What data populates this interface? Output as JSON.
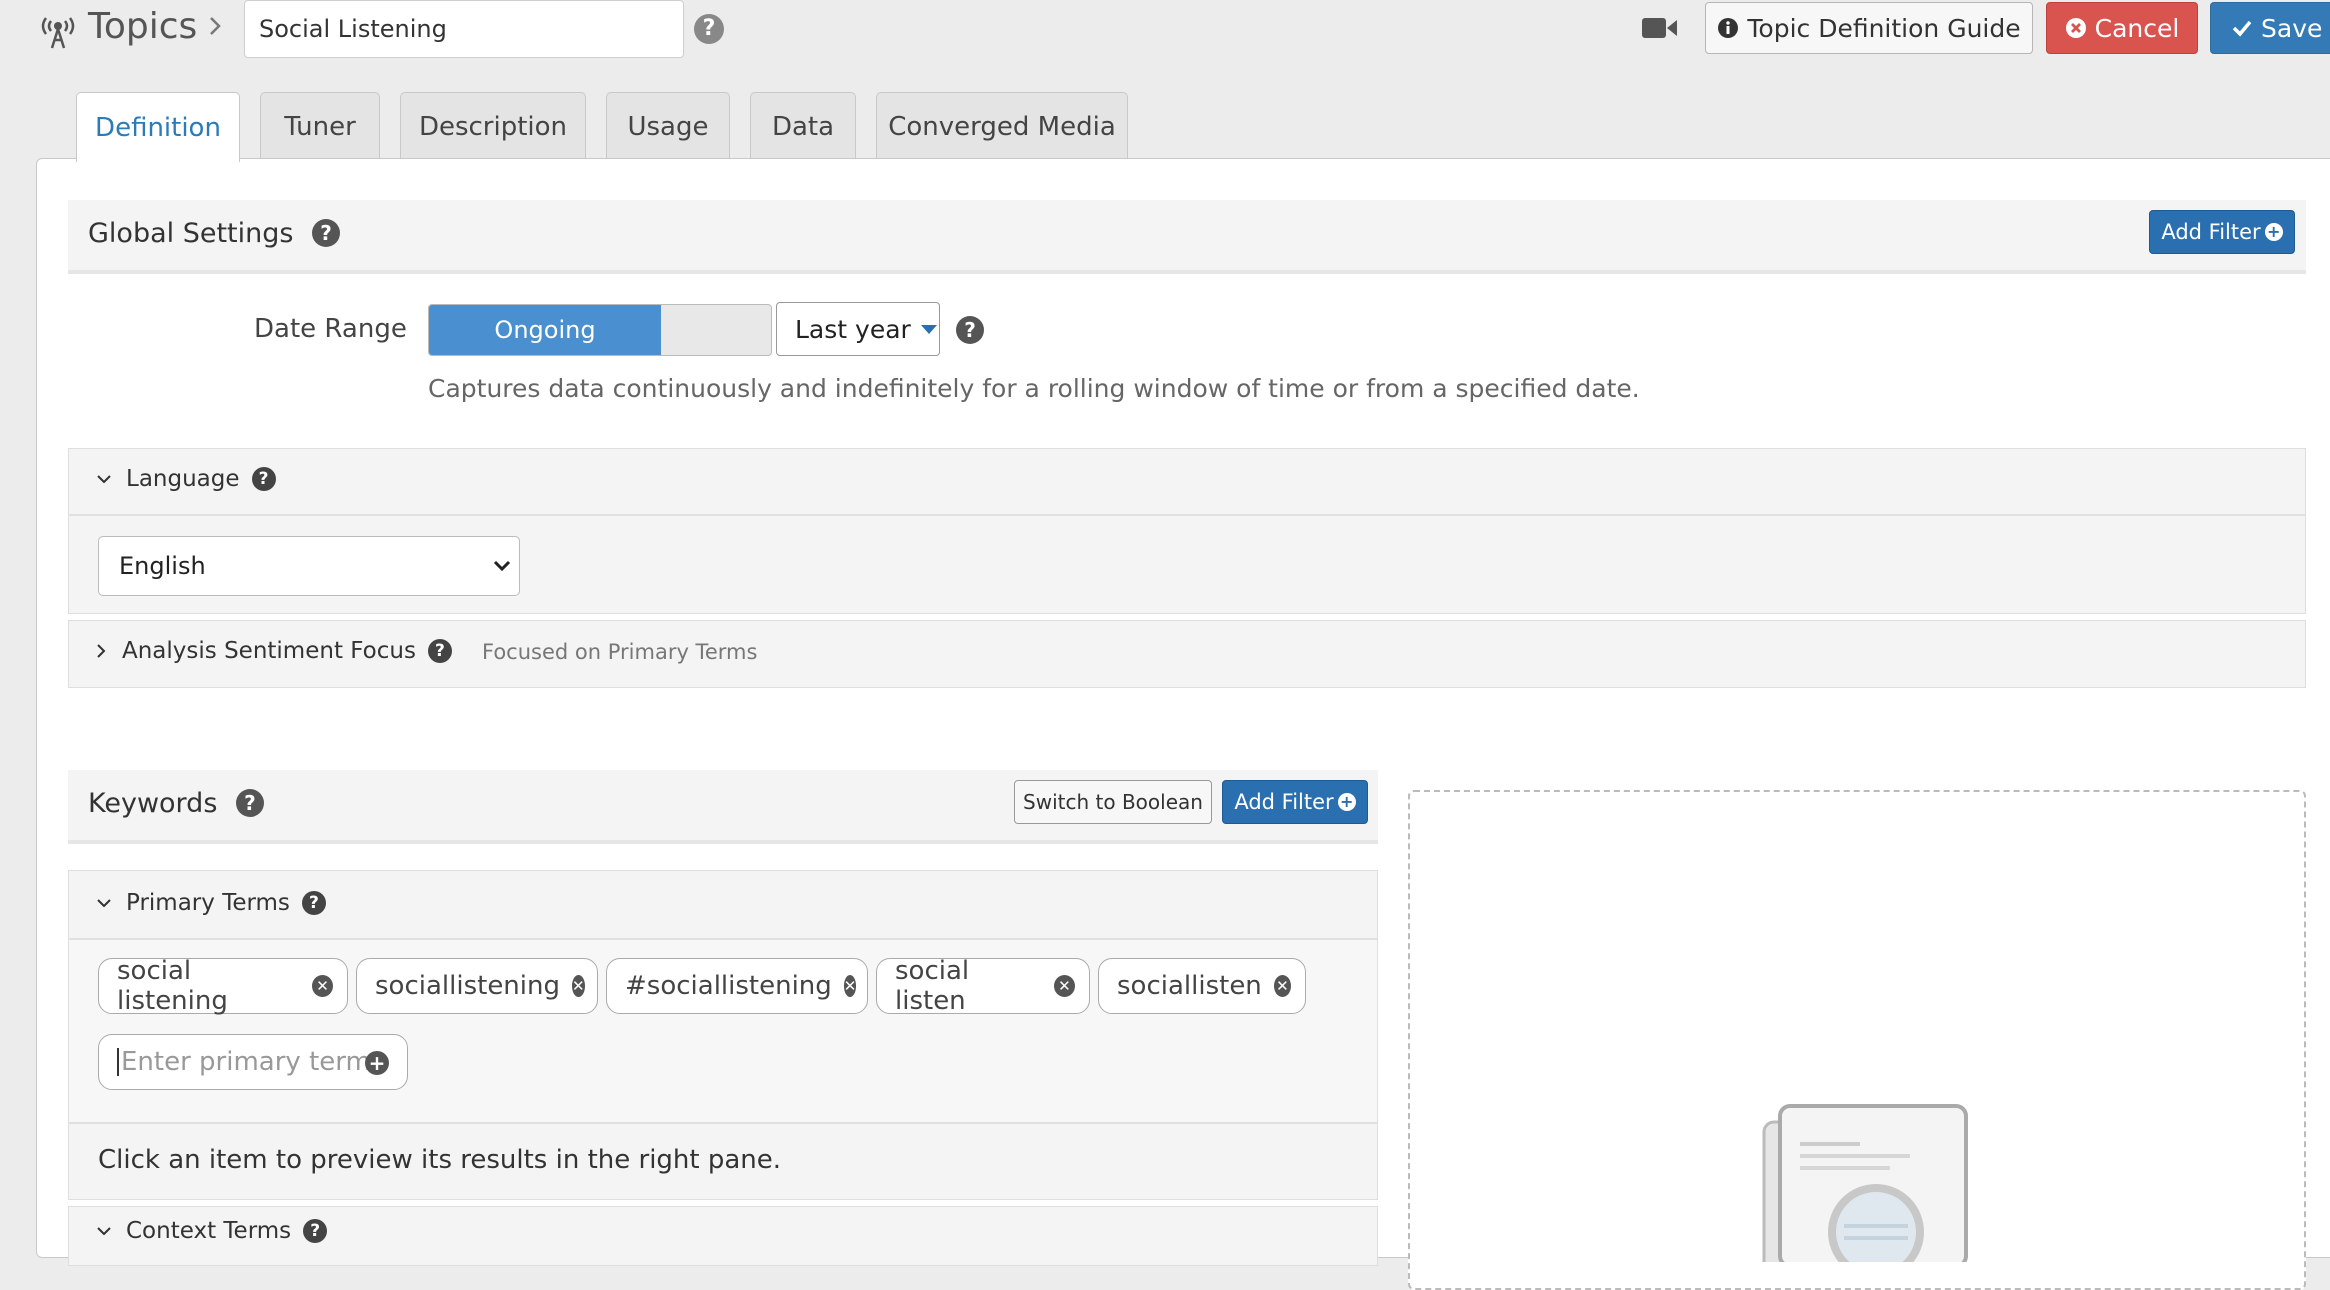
{
  "header": {
    "breadcrumb_title": "Topics",
    "topic_name": "Social Listening",
    "guide_button": "Topic Definition Guide",
    "cancel_button": "Cancel",
    "save_button": "Save"
  },
  "tabs": [
    {
      "label": "Definition",
      "active": true
    },
    {
      "label": "Tuner"
    },
    {
      "label": "Description"
    },
    {
      "label": "Usage"
    },
    {
      "label": "Data"
    },
    {
      "label": "Converged Media"
    }
  ],
  "global_settings": {
    "title": "Global Settings",
    "add_filter": "Add Filter",
    "date_range_label": "Date Range",
    "date_range_toggle": "Ongoing",
    "date_range_value": "Last year",
    "date_range_help": "Captures data continuously and indefinitely for a rolling window of time or from a specified date."
  },
  "language": {
    "title": "Language",
    "selected": "English"
  },
  "analysis_sentiment": {
    "title": "Analysis Sentiment Focus",
    "note": "Focused on Primary Terms"
  },
  "keywords": {
    "title": "Keywords",
    "switch_button": "Switch to Boolean",
    "add_filter": "Add Filter",
    "primary_terms_title": "Primary Terms",
    "terms": [
      "social listening",
      "sociallistening",
      "#sociallistening",
      "social listen",
      "sociallisten"
    ],
    "input_placeholder": "Enter primary term",
    "preview_note": "Click an item to preview its results in the right pane.",
    "next_section_partial": "Context Terms"
  },
  "colors": {
    "primary": "#337ab7",
    "danger": "#d9534f",
    "active_tab_text": "#2b7bb9"
  }
}
